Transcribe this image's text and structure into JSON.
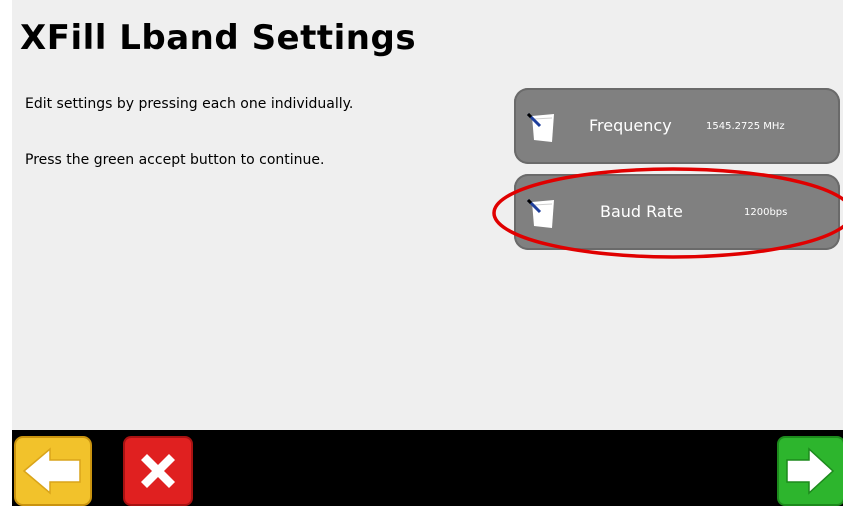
{
  "page": {
    "title": "XFill Lband Settings",
    "instructions": [
      "Edit settings by pressing each one individually.",
      "Press the green accept button to continue."
    ]
  },
  "settings": [
    {
      "label": "Frequency",
      "value": "1545.2725 MHz",
      "icon": "edit-note-icon"
    },
    {
      "label": "Baud Rate",
      "value": "1200bps",
      "icon": "edit-note-icon"
    }
  ],
  "toolbar": {
    "back": {
      "icon": "arrow-left-icon",
      "color": "#f2c22b"
    },
    "cancel": {
      "icon": "close-x-icon",
      "color": "#e02020"
    },
    "accept": {
      "icon": "arrow-right-icon",
      "color": "#2db52d"
    }
  },
  "annotation": {
    "highlight_color": "#e00000"
  }
}
